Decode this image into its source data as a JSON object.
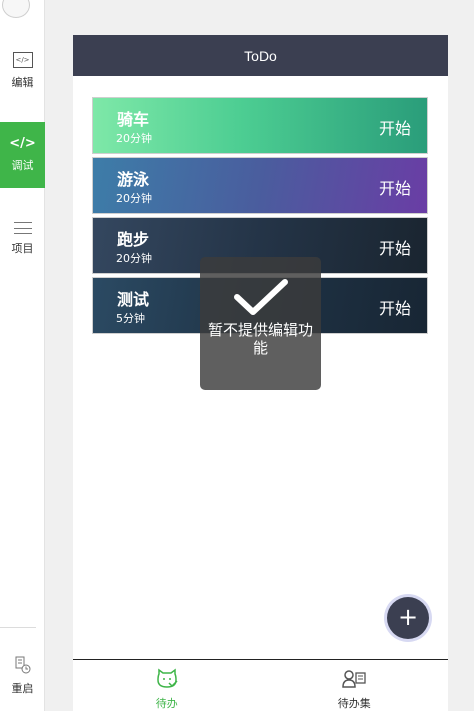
{
  "sidebar": {
    "edit_label": "编辑",
    "debug_label": "调试",
    "debug_icon": "</>",
    "project_label": "项目",
    "restart_label": "重启"
  },
  "app": {
    "title": "ToDo"
  },
  "todos": [
    {
      "name": "骑车",
      "duration": "20分钟",
      "action": "开始"
    },
    {
      "name": "游泳",
      "duration": "20分钟",
      "action": "开始"
    },
    {
      "name": "跑步",
      "duration": "20分钟",
      "action": "开始"
    },
    {
      "name": "测试",
      "duration": "5分钟",
      "action": "开始"
    }
  ],
  "toast": {
    "message": "暂不提供编辑功能",
    "icon": "checkmark-icon"
  },
  "fab": {
    "label": "+"
  },
  "tabbar": {
    "tabs": [
      {
        "label": "待办",
        "active": true
      },
      {
        "label": "待办集",
        "active": false
      }
    ]
  },
  "colors": {
    "navbar": "#3b3f51",
    "accent": "#3fb549"
  }
}
